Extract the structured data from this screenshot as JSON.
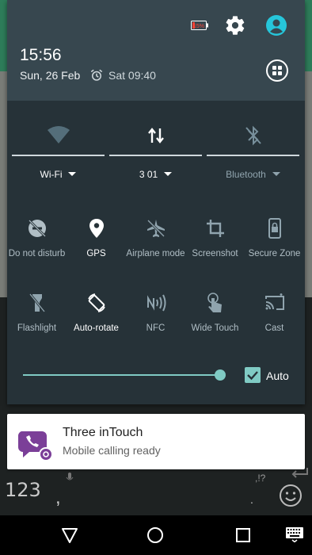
{
  "status": {
    "battery_text": "15%",
    "time": "15:56",
    "date": "Sun, 26 Feb",
    "alarm": "Sat 09:40"
  },
  "toggles": [
    {
      "label": "Wi-Fi",
      "icon": "wifi-icon"
    },
    {
      "label": "3 01",
      "icon": "mobile-data-icon"
    },
    {
      "label": "Bluetooth",
      "icon": "bluetooth-off-icon"
    }
  ],
  "tiles": [
    {
      "label": "Do not disturb",
      "icon": "do-not-disturb-icon",
      "active": false
    },
    {
      "label": "GPS",
      "icon": "location-pin-icon",
      "active": true
    },
    {
      "label": "Airplane mode",
      "icon": "airplane-icon",
      "active": false
    },
    {
      "label": "Screenshot",
      "icon": "crop-icon",
      "active": false
    },
    {
      "label": "Secure Zone",
      "icon": "secure-zone-icon",
      "active": false
    },
    {
      "label": "Flashlight",
      "icon": "flashlight-icon",
      "active": false
    },
    {
      "label": "Auto-rotate",
      "icon": "auto-rotate-icon",
      "active": true
    },
    {
      "label": "NFC",
      "icon": "nfc-icon",
      "active": false
    },
    {
      "label": "Wide Touch",
      "icon": "touch-icon",
      "active": false
    },
    {
      "label": "Cast",
      "icon": "cast-icon",
      "active": false
    }
  ],
  "brightness": {
    "level": 1.0,
    "auto_label": "Auto",
    "auto_checked": true
  },
  "notification": {
    "title": "Three inTouch",
    "text": "Mobile calling ready"
  },
  "keyboard": {
    "numbers_key": "123",
    "comma_key": ",",
    "punct_key": ",!?",
    "period_key": "."
  },
  "colors": {
    "accent": "#80cbc4",
    "shade_bg": "#263238",
    "header_bg": "#37474f",
    "notif_icon": "#7b3f98"
  }
}
